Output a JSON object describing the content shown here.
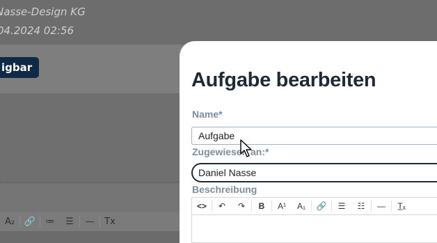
{
  "background": {
    "company": "Nasse-Design KG",
    "date": "04.2024 02:56",
    "button_label": "igbar",
    "toolbar": [
      "A₂",
      "🔗",
      "≔",
      "☰",
      "—",
      "Tx"
    ]
  },
  "modal": {
    "title": "Aufgabe bearbeiten",
    "name_label": "Name*",
    "name_value": "Aufgabe",
    "assigned_label": "Zugewiesen an:*",
    "assigned_value": "Daniel Nasse",
    "description_label": "Beschreibung",
    "editor_toolbar": {
      "source": "<>",
      "undo": "↶",
      "redo": "↷",
      "bold": "B",
      "superscript": "A¹",
      "subscript": "A₁",
      "link": "🔗",
      "bullet_list": "☰",
      "numbered_list": "☷",
      "hr": "—",
      "clear_format": "T̲ₓ"
    }
  }
}
